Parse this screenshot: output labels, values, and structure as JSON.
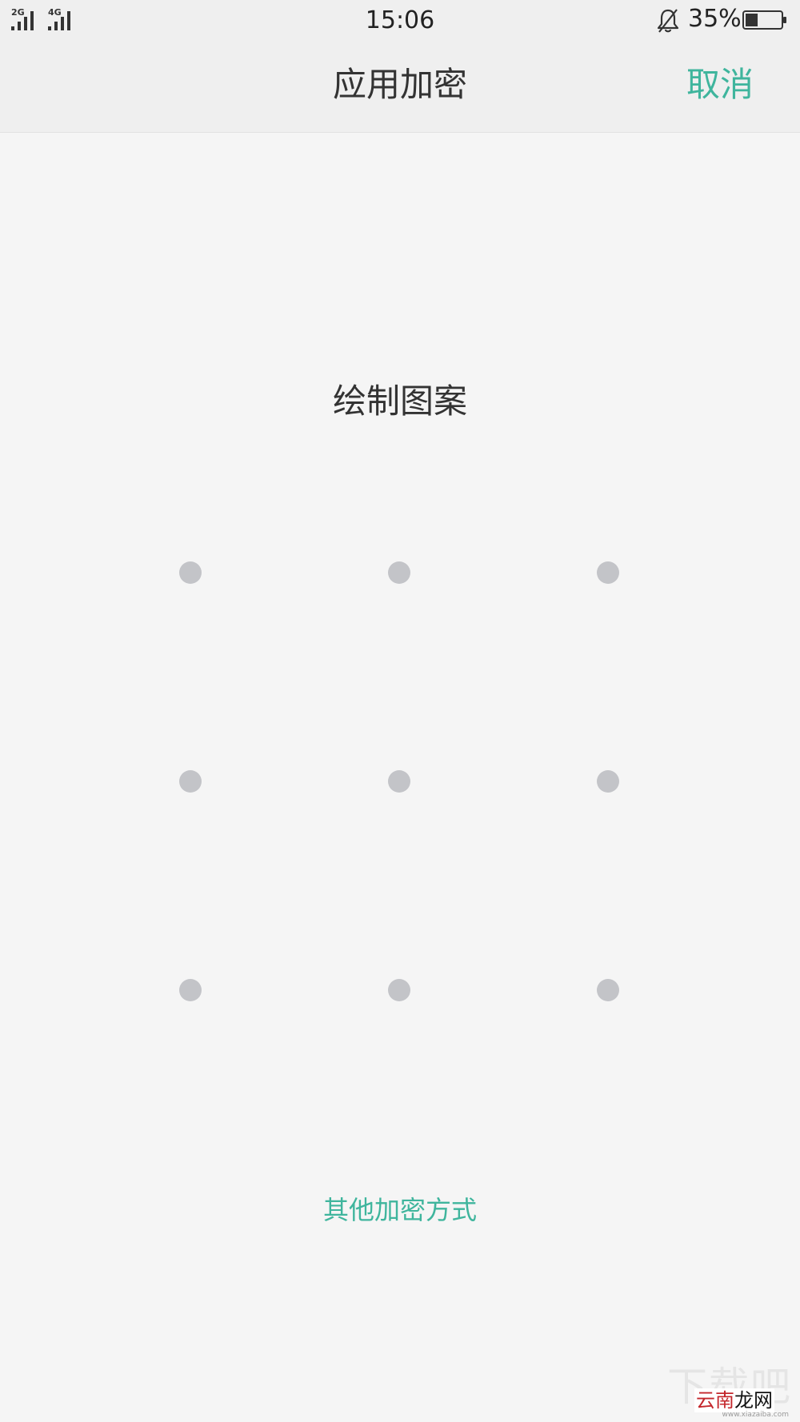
{
  "status_bar": {
    "signal_1_label": "2G",
    "signal_2_label": "4G",
    "time": "15:06",
    "battery_percent": "35%",
    "battery_level": 0.35,
    "icons": [
      "signal-icon",
      "signal-icon",
      "bell-off-icon",
      "battery-icon"
    ]
  },
  "header": {
    "title": "应用加密",
    "cancel_label": "取消"
  },
  "main": {
    "prompt": "绘制图案",
    "pattern_dots": [
      {
        "row": 1,
        "col": 1
      },
      {
        "row": 1,
        "col": 2
      },
      {
        "row": 1,
        "col": 3
      },
      {
        "row": 2,
        "col": 1
      },
      {
        "row": 2,
        "col": 2
      },
      {
        "row": 2,
        "col": 3
      },
      {
        "row": 3,
        "col": 1
      },
      {
        "row": 3,
        "col": 2
      },
      {
        "row": 3,
        "col": 3
      }
    ],
    "other_method_label": "其他加密方式"
  },
  "watermark": {
    "top_text": "下载吧",
    "red_text": "云南",
    "black_text": "龙网",
    "url": "www.xiazaiba.com"
  },
  "colors": {
    "accent": "#3fb59d",
    "dot": "#c3c4c8",
    "background": "#f5f5f5",
    "bar_background": "#efefef",
    "text": "#333333"
  }
}
